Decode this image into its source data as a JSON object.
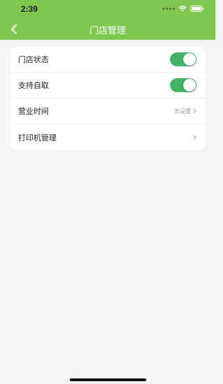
{
  "status_bar": {
    "time": "2:39",
    "icons": [
      "signal-dots-icon",
      "wifi-icon",
      "battery-icon"
    ]
  },
  "header": {
    "title": "门店管理",
    "back_icon": "chevron-left-icon",
    "background": "#7ec850"
  },
  "settings": {
    "rows": [
      {
        "label": "门店状态",
        "control": "toggle",
        "on": true
      },
      {
        "label": "支持自取",
        "control": "toggle",
        "on": true
      },
      {
        "label": "营业时间",
        "control": "link",
        "hint": "去设置"
      },
      {
        "label": "打印机管理",
        "control": "link",
        "hint": ""
      }
    ]
  },
  "colors": {
    "toggle_on": "#43b463",
    "page_background": "#f5f5f7"
  }
}
